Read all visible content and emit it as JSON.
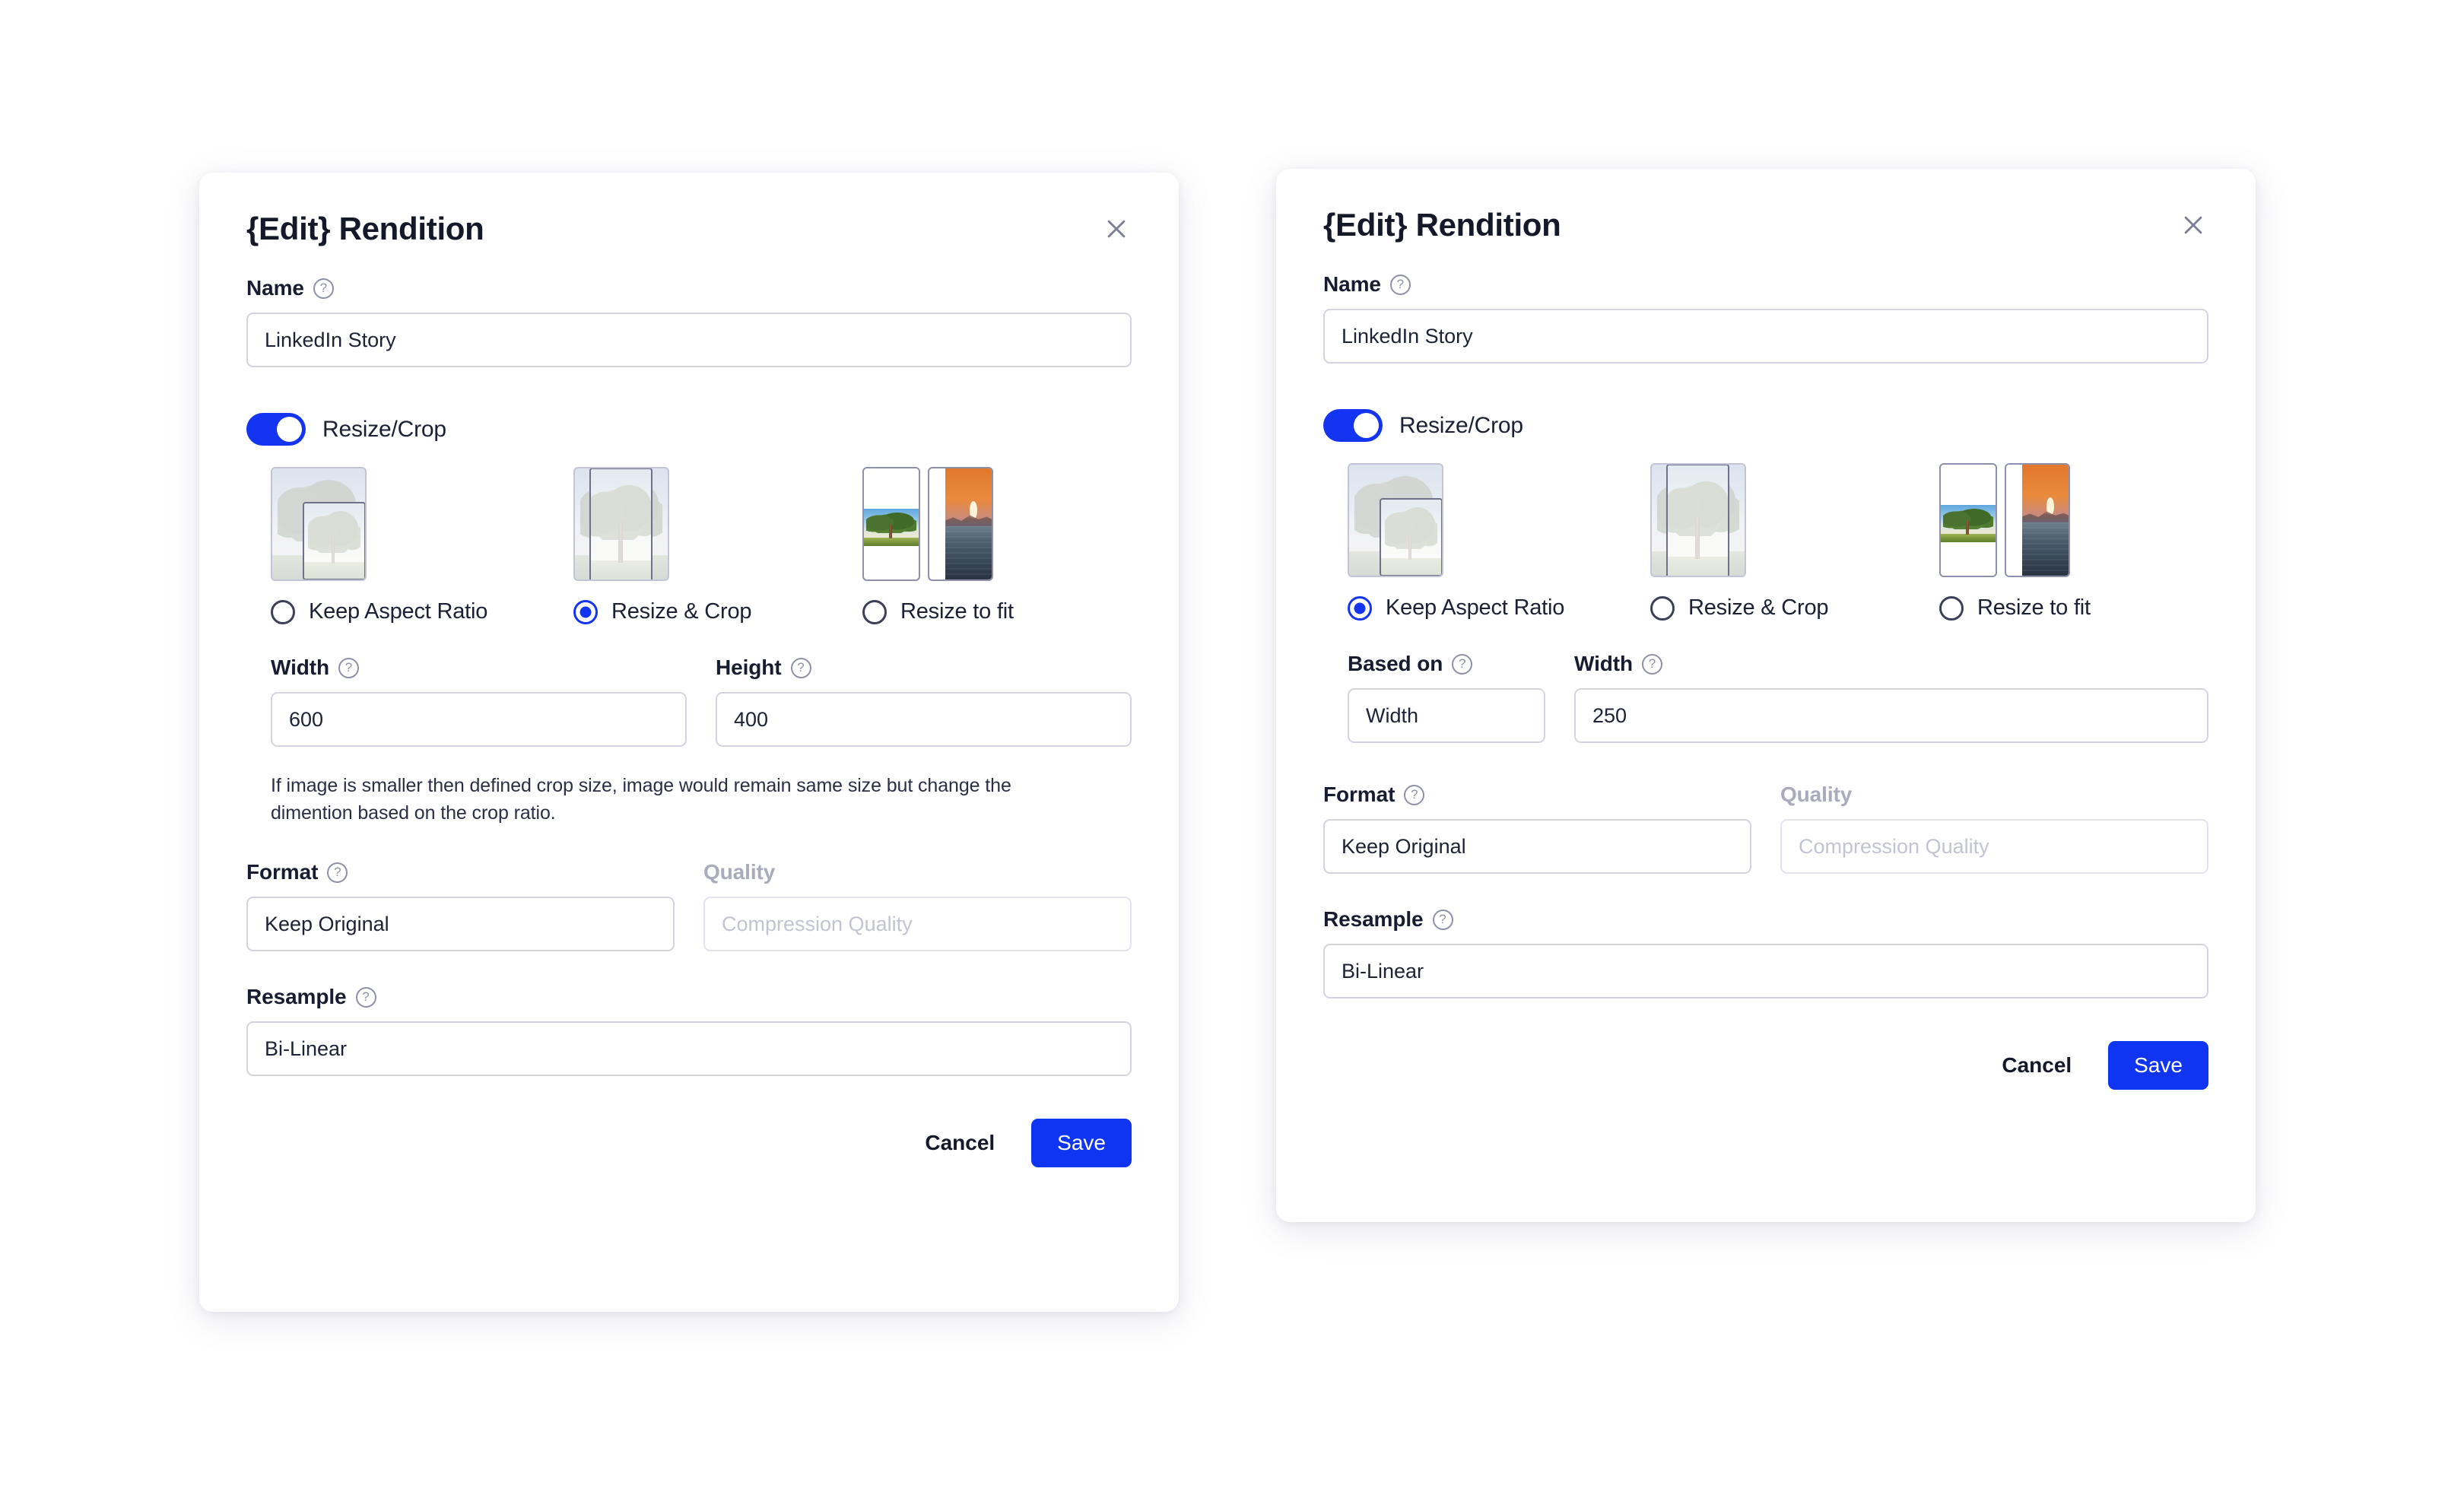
{
  "theme": {
    "accent": "#1335f2",
    "save_button_bg": "#0f35f2",
    "page_bg": "#ffffff",
    "card_bg": "#ffffff",
    "text": "#171c31",
    "muted_text": "#a9abbd",
    "border": "#d3d4df",
    "help_icon": "#8e90a8"
  },
  "icons": {
    "close": "close-icon",
    "help": "help-circle-icon"
  },
  "common": {
    "title": "{Edit} Rendition",
    "name_label": "Name",
    "name_value": "LinkedIn Story",
    "resize_crop_label": "Resize/Crop",
    "format_label": "Format",
    "format_value": "Keep Original",
    "quality_label": "Quality",
    "quality_placeholder": "Compression Quality",
    "resample_label": "Resample",
    "resample_value": "Bi-Linear",
    "cancel_label": "Cancel",
    "save_label": "Save",
    "modes": [
      {
        "label": "Keep Aspect Ratio"
      },
      {
        "label": "Resize & Crop"
      },
      {
        "label": "Resize to fit"
      }
    ]
  },
  "left_card": {
    "title": "{Edit} Rendition",
    "name_label": "Name",
    "name_value": "LinkedIn Story",
    "resize_crop_label": "Resize/Crop",
    "selected_mode": "Resize & Crop",
    "modes": [
      {
        "label": "Keep Aspect Ratio",
        "selected": false
      },
      {
        "label": "Resize & Crop",
        "selected": true
      },
      {
        "label": "Resize to fit",
        "selected": false
      }
    ],
    "width_label": "Width",
    "width_value": "600",
    "height_label": "Height",
    "height_value": "400",
    "hint": "If image is smaller then defined crop size, image would remain same size but change the dimention based on the crop ratio.",
    "format_label": "Format",
    "format_value": "Keep Original",
    "quality_label": "Quality",
    "quality_placeholder": "Compression Quality",
    "resample_label": "Resample",
    "resample_value": "Bi-Linear",
    "cancel_label": "Cancel",
    "save_label": "Save"
  },
  "right_card": {
    "title": "{Edit} Rendition",
    "name_label": "Name",
    "name_value": "LinkedIn Story",
    "resize_crop_label": "Resize/Crop",
    "selected_mode": "Keep Aspect Ratio",
    "modes": [
      {
        "label": "Keep Aspect Ratio",
        "selected": true
      },
      {
        "label": "Resize & Crop",
        "selected": false
      },
      {
        "label": "Resize to fit",
        "selected": false
      }
    ],
    "based_on_label": "Based on",
    "based_on_value": "Width",
    "width_label": "Width",
    "width_value": "250",
    "format_label": "Format",
    "format_value": "Keep Original",
    "quality_label": "Quality",
    "quality_placeholder": "Compression Quality",
    "resample_label": "Resample",
    "resample_value": "Bi-Linear",
    "cancel_label": "Cancel",
    "save_label": "Save"
  }
}
